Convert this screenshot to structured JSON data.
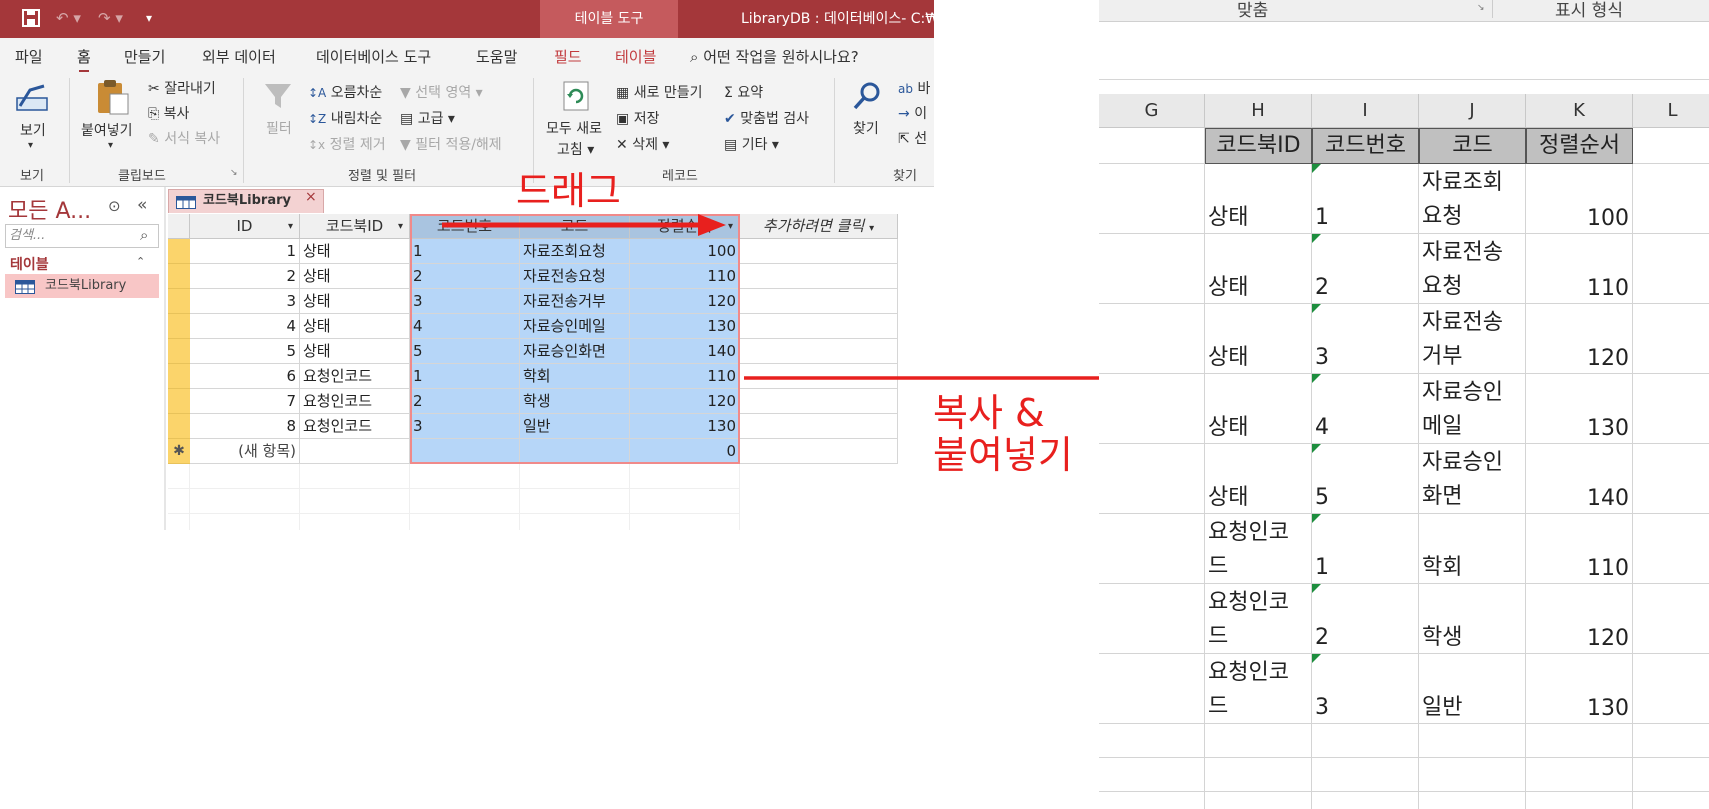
{
  "access": {
    "ctx_tab": "테이블 도구",
    "window_title": "LibraryDB : 데이터베이스- C:₩",
    "menus": [
      "파일",
      "홈",
      "만들기",
      "외부 데이터",
      "데이터베이스 도구",
      "도움말",
      "필드",
      "테이블"
    ],
    "tellme": "어떤 작업을 원하시나요?",
    "ribbon": {
      "view": "보기",
      "paste": "붙여넣기",
      "cut": "잘라내기",
      "copy": "복사",
      "format_painter": "서식 복사",
      "clipboard_group": "클립보드",
      "view_group": "보기",
      "filter": "필터",
      "ascending": "오름차순",
      "descending": "내림차순",
      "remove_sort": "정렬 제거",
      "selection": "선택 영역",
      "advanced": "고급",
      "toggle_filter": "필터 적용/해제",
      "sort_filter_group": "정렬 및 필터",
      "refresh_all_1": "모두 새로",
      "refresh_all_2": "고침",
      "new": "새로 만들기",
      "save": "저장",
      "delete": "삭제",
      "totals": "요약",
      "spelling": "맞춤법 검사",
      "more": "기타",
      "records_group": "레코드",
      "find": "찾기",
      "find_group": "찾기",
      "replace": "바",
      "goto": "이",
      "select": "선"
    },
    "nav": {
      "title": "모든 A...",
      "search_placeholder": "검색...",
      "section": "테이블",
      "item": "코드북Library"
    },
    "doc_tab": "코드북Library",
    "columns": [
      "ID",
      "코드북ID",
      "코드번호",
      "코드",
      "정렬순서",
      "추가하려면 클릭"
    ],
    "rows": [
      {
        "id": "1",
        "book": "상태",
        "num": "1",
        "code": "자료조회요청",
        "order": "100"
      },
      {
        "id": "2",
        "book": "상태",
        "num": "2",
        "code": "자료전송요청",
        "order": "110"
      },
      {
        "id": "3",
        "book": "상태",
        "num": "3",
        "code": "자료전송거부",
        "order": "120"
      },
      {
        "id": "4",
        "book": "상태",
        "num": "4",
        "code": "자료승인메일",
        "order": "130"
      },
      {
        "id": "5",
        "book": "상태",
        "num": "5",
        "code": "자료승인화면",
        "order": "140"
      },
      {
        "id": "6",
        "book": "요청인코드",
        "num": "1",
        "code": "학회",
        "order": "110"
      },
      {
        "id": "7",
        "book": "요청인코드",
        "num": "2",
        "code": "학생",
        "order": "120"
      },
      {
        "id": "8",
        "book": "요청인코드",
        "num": "3",
        "code": "일반",
        "order": "130"
      }
    ],
    "new_row": {
      "id": "(새 항목)",
      "order": "0"
    }
  },
  "annotations": {
    "drag": "드래그",
    "paste_line1": "복사 &",
    "paste_line2": "붙여넣기",
    "color": "#e8201e"
  },
  "excel": {
    "ribbon_labels": [
      "맞춤",
      "표시 형식"
    ],
    "columns": [
      "G",
      "H",
      "I",
      "J",
      "K",
      "L"
    ],
    "headers": [
      "코드북ID",
      "코드번호",
      "코드",
      "정렬순서"
    ],
    "rows": [
      {
        "book": "상태",
        "num": "1",
        "code": "자료조회요청",
        "order": "100"
      },
      {
        "book": "상태",
        "num": "2",
        "code": "자료전송요청",
        "order": "110"
      },
      {
        "book": "상태",
        "num": "3",
        "code": "자료전송거부",
        "order": "120"
      },
      {
        "book": "상태",
        "num": "4",
        "code": "자료승인메일",
        "order": "130"
      },
      {
        "book": "상태",
        "num": "5",
        "code": "자료승인화면",
        "order": "140"
      },
      {
        "book": "요청인코드",
        "num": "1",
        "code": "학회",
        "order": "110"
      },
      {
        "book": "요청인코드",
        "num": "2",
        "code": "학생",
        "order": "120"
      },
      {
        "book": "요청인코드",
        "num": "3",
        "code": "일반",
        "order": "130"
      }
    ]
  }
}
